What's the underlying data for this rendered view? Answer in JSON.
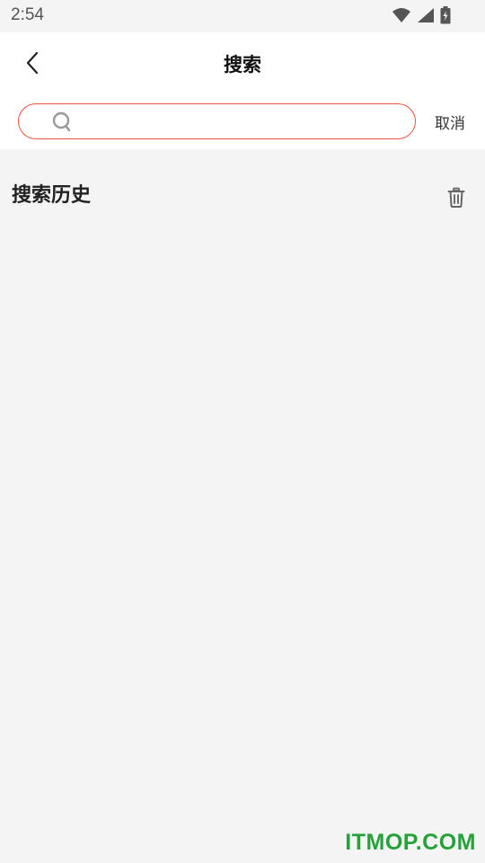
{
  "status_bar": {
    "time": "2:54",
    "icons": [
      "wifi-icon",
      "signal-icon",
      "battery-icon"
    ]
  },
  "header": {
    "back_icon": "chevron-left-icon",
    "title": "搜索"
  },
  "search": {
    "icon": "search-icon",
    "value": "",
    "placeholder": "",
    "cancel_label": "取消",
    "accent_color": "#e8553e"
  },
  "history": {
    "title": "搜索历史",
    "clear_icon": "trash-icon",
    "items": []
  },
  "watermark": "ITMOP.COM"
}
